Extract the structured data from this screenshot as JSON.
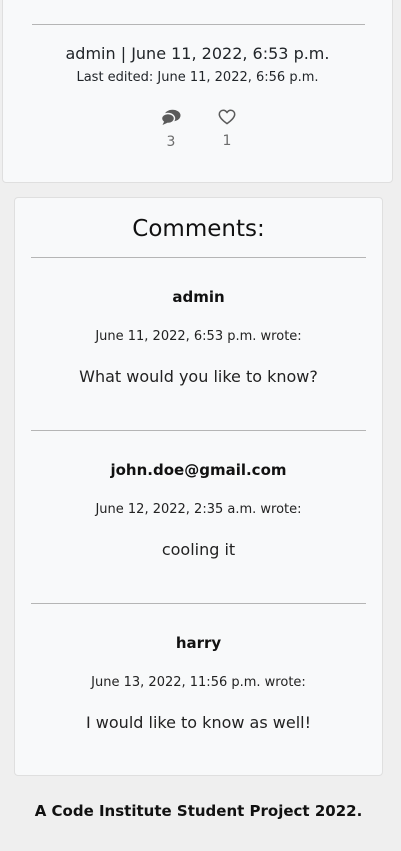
{
  "post": {
    "author_line": "admin | June 11, 2022, 6:53 p.m.",
    "edited_line": "Last edited: June 11, 2022, 6:56 p.m.",
    "comments_icon": "comments-icon",
    "comments_count": "3",
    "likes_icon": "heart-outline-icon",
    "likes_count": "1"
  },
  "comments_section": {
    "title": "Comments:",
    "items": [
      {
        "author": "admin",
        "date_line": "June 11, 2022, 6:53 p.m. wrote:",
        "body": "What would you like to know?"
      },
      {
        "author": "john.doe@gmail.com",
        "date_line": "June 12, 2022, 2:35 a.m. wrote:",
        "body": "cooling it"
      },
      {
        "author": "harry",
        "date_line": "June 13, 2022, 11:56 p.m. wrote:",
        "body": "I would like to know as well!"
      }
    ]
  },
  "footer": {
    "text": "A Code Institute Student Project 2022."
  },
  "colors": {
    "page_background": "#efefef",
    "card_background": "#f8f9fa",
    "card_border": "#dfdfdf",
    "divider": "#b5b5b5",
    "text": "#212529",
    "muted_text": "#6c6c6c"
  }
}
